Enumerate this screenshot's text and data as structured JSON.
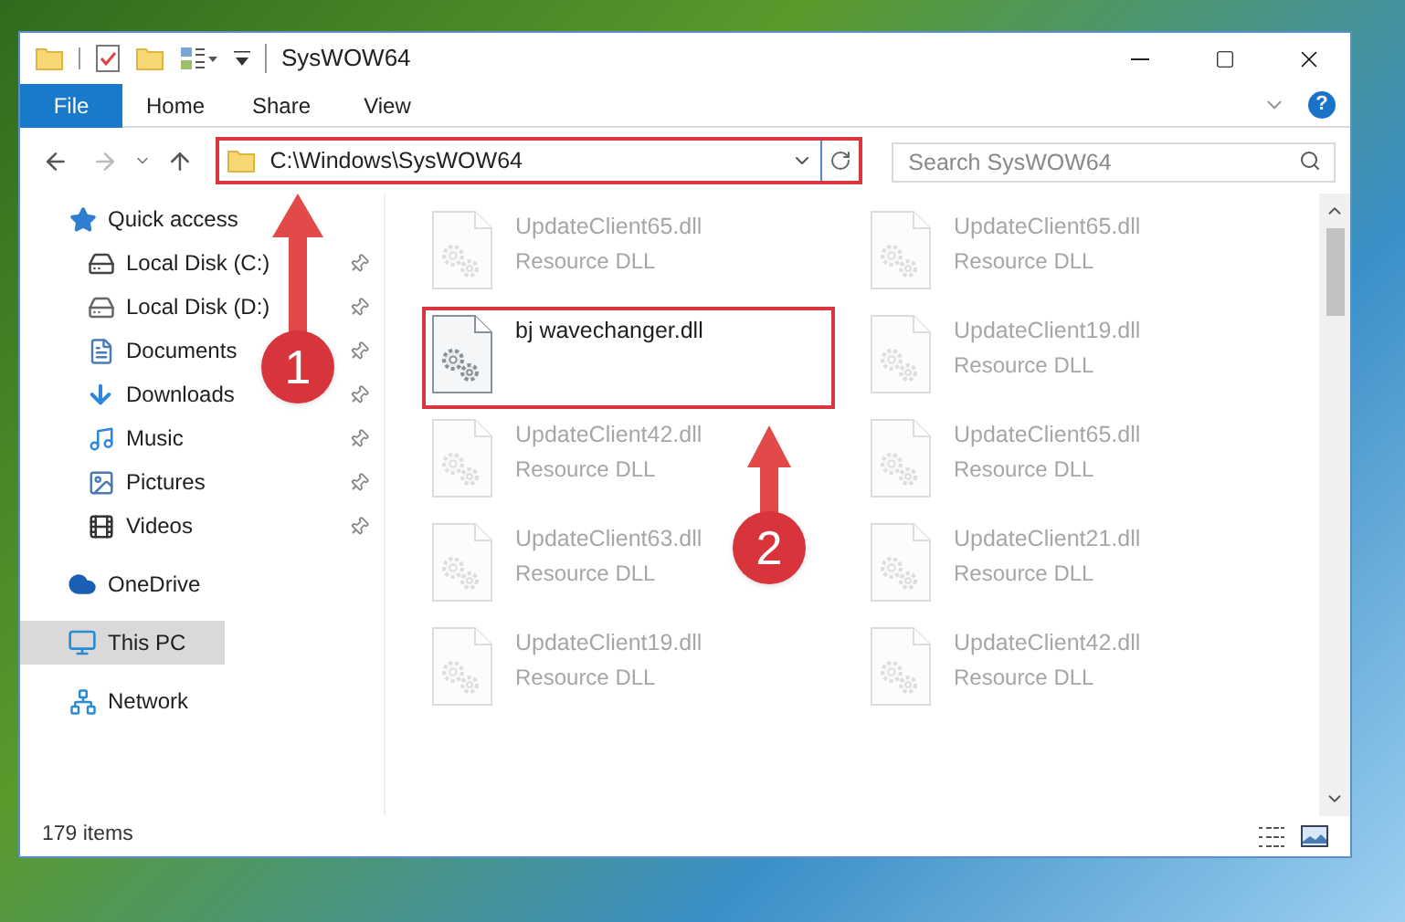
{
  "window": {
    "title": "SysWOW64"
  },
  "ribbon": {
    "tabs": [
      {
        "label": "File",
        "selected": true
      },
      {
        "label": "Home",
        "selected": false
      },
      {
        "label": "Share",
        "selected": false
      },
      {
        "label": "View",
        "selected": false
      }
    ],
    "help_label": "?"
  },
  "address_bar": {
    "path": "C:\\Windows\\SysWOW64",
    "highlighted": true
  },
  "search": {
    "placeholder": "Search SysWOW64"
  },
  "sidebar": {
    "items": [
      {
        "label": "Quick access",
        "kind": "star",
        "selected": false,
        "children": [
          {
            "label": "Local Disk (C:)",
            "kind": "system-drive",
            "pinned": true,
            "selected": false
          },
          {
            "label": "Local Disk (D:)",
            "kind": "drive",
            "pinned": true,
            "selected": false
          },
          {
            "label": "Documents",
            "kind": "document",
            "pinned": true,
            "selected": false
          },
          {
            "label": "Downloads",
            "kind": "download",
            "pinned": true,
            "selected": false
          },
          {
            "label": "Music",
            "kind": "music",
            "pinned": true,
            "selected": false
          },
          {
            "label": "Pictures",
            "kind": "picture",
            "pinned": true,
            "selected": false
          },
          {
            "label": "Videos",
            "kind": "video",
            "pinned": true,
            "selected": false
          }
        ]
      },
      {
        "label": "OneDrive",
        "kind": "cloud",
        "selected": false
      },
      {
        "label": "This PC",
        "kind": "computer",
        "selected": true
      },
      {
        "label": "Network",
        "kind": "network",
        "selected": false
      }
    ]
  },
  "files": [
    {
      "name": "UpdateClient65.dll",
      "type": "Resource DLL",
      "highlighted": false
    },
    {
      "name": "UpdateClient65.dll",
      "type": "Resource DLL",
      "highlighted": false
    },
    {
      "name": "bj wavechanger.dll",
      "highlighted": true
    },
    {
      "name": "UpdateClient19.dll",
      "type": "Resource DLL",
      "highlighted": false
    },
    {
      "name": "UpdateClient42.dll",
      "type": "Resource DLL",
      "highlighted": false
    },
    {
      "name": "UpdateClient65.dll",
      "type": "Resource DLL",
      "highlighted": false
    },
    {
      "name": "UpdateClient63.dll",
      "type": "Resource DLL",
      "highlighted": false
    },
    {
      "name": "UpdateClient21.dll",
      "type": "Resource DLL",
      "highlighted": false
    },
    {
      "name": "UpdateClient19.dll",
      "type": "Resource DLL",
      "highlighted": false
    },
    {
      "name": "UpdateClient42.dll",
      "type": "Resource DLL",
      "highlighted": false
    }
  ],
  "status_bar": {
    "item_count": "179 items"
  },
  "annotations": [
    {
      "number": "1"
    },
    {
      "number": "2"
    }
  ]
}
